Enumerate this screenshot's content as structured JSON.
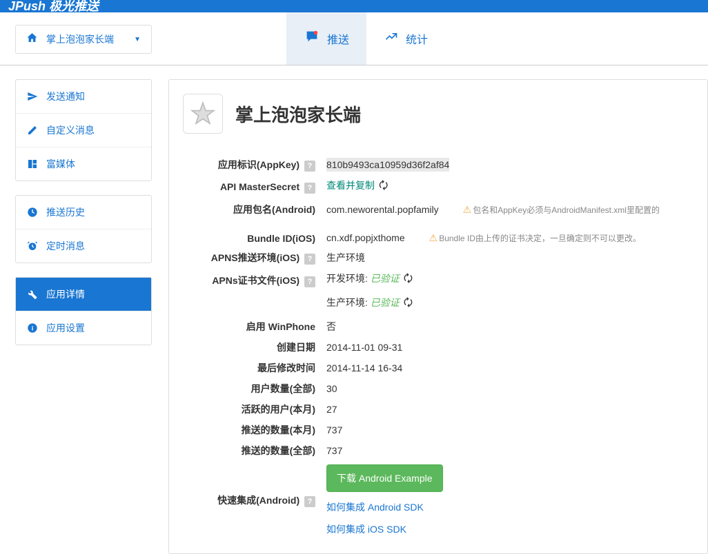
{
  "brand": "JPush 极光推送",
  "appSelector": "掌上泡泡家长端",
  "navTabs": [
    {
      "label": "推送",
      "icon": "chat",
      "active": true
    },
    {
      "label": "统计",
      "icon": "chart",
      "active": false
    }
  ],
  "sidebar": {
    "group1": [
      {
        "label": "发送通知",
        "icon": "send"
      },
      {
        "label": "自定义消息",
        "icon": "edit"
      },
      {
        "label": "富媒体",
        "icon": "media"
      }
    ],
    "group2": [
      {
        "label": "推送历史",
        "icon": "clock"
      },
      {
        "label": "定时消息",
        "icon": "alarm"
      }
    ],
    "group3": [
      {
        "label": "应用详情",
        "icon": "wrench",
        "active": true
      },
      {
        "label": "应用设置",
        "icon": "info"
      }
    ]
  },
  "pageTitle": "掌上泡泡家长端",
  "fields": {
    "appKey": {
      "label": "应用标识(AppKey)",
      "value": "810b9493ca10959d36f2af84",
      "help": true
    },
    "masterSecret": {
      "label": "API MasterSecret",
      "value": "查看并复制",
      "help": true
    },
    "packageName": {
      "label": "应用包名(Android)",
      "value": "com.neworental.popfamily",
      "warning": "包名和AppKey必须与AndroidManifest.xml里配置的"
    },
    "bundleId": {
      "label": "Bundle ID(iOS)",
      "value": "cn.xdf.popjxthome",
      "warning": "Bundle ID由上传的证书决定，一旦确定则不可以更改。"
    },
    "apnsEnv": {
      "label": "APNS推送环境(iOS)",
      "value": "生产环境",
      "help": true
    },
    "apnsCert": {
      "label": "APNs证书文件(iOS)",
      "devLabel": "开发环境:",
      "prodLabel": "生产环境:",
      "status": "已验证",
      "help": true
    },
    "winPhone": {
      "label": "启用 WinPhone",
      "value": "否"
    },
    "createDate": {
      "label": "创建日期",
      "value": "2014-11-01 09-31"
    },
    "modifyDate": {
      "label": "最后修改时间",
      "value": "2014-11-14 16-34"
    },
    "userCount": {
      "label": "用户数量(全部)",
      "value": "30"
    },
    "activeUsers": {
      "label": "活跃的用户(本月)",
      "value": "27"
    },
    "pushMonth": {
      "label": "推送的数量(本月)",
      "value": "737"
    },
    "pushAll": {
      "label": "推送的数量(全部)",
      "value": "737"
    },
    "quickSetup": {
      "label": "快速集成(Android)",
      "button": "下载 Android Example",
      "help": true
    }
  },
  "links": {
    "androidSdk": "如何集成 Android SDK",
    "iosSdk": "如何集成 iOS SDK"
  }
}
